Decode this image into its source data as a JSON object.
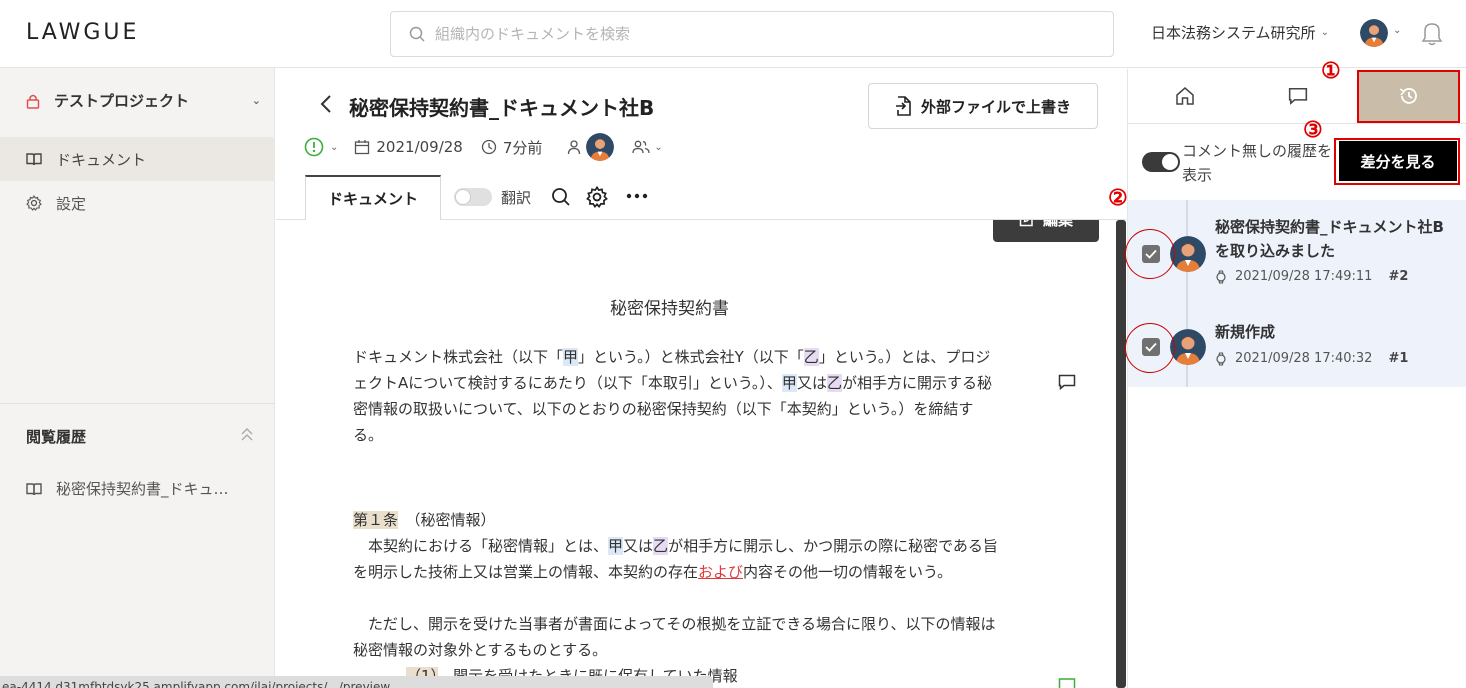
{
  "app": {
    "logo": "LAWGUE"
  },
  "search": {
    "placeholder": "組織内のドキュメントを検索"
  },
  "header": {
    "org_name": "日本法務システム研究所"
  },
  "sidebar": {
    "project_name": "テストプロジェクト",
    "nav": [
      {
        "label": "ドキュメント",
        "icon": "book-icon",
        "active": true
      },
      {
        "label": "設定",
        "icon": "gear-icon",
        "active": false
      }
    ],
    "history_title": "閲覧履歴",
    "history_items": [
      {
        "label": "秘密保持契約書_ドキュ…"
      }
    ]
  },
  "status_url": "ea-4414.d31mfbtdsyk25.amplifyapp.com/ilai/projects/.../preview",
  "document": {
    "title": "秘密保持契約書_ドキュメント社B",
    "overwrite_button": "外部ファイルで上書き",
    "date": "2021/09/28",
    "updated_ago": "7分前",
    "tab_label": "ドキュメント",
    "translate_label": "翻訳",
    "edit_button": "編集",
    "contract_title": "秘密保持契約書",
    "p1": {
      "a": "ドキュメント株式会社（以下「",
      "kou1": "甲",
      "b": "」という。）と株式会社Y（以下「",
      "otsu1": "乙",
      "c": "」という。）とは、プロジェクトAについて検討するにあたり（以下「本取引」という。）、",
      "kou2": "甲",
      "d": "又は",
      "otsu2": "乙",
      "e": "が相手方に開示する秘密情報の取扱いについて、以下のとおりの秘密保持契約（以下「本契約」という。）を締結する。"
    },
    "article1": {
      "number": "第１条",
      "heading": "（秘密情報）"
    },
    "p2": {
      "a": "　本契約における「秘密情報」とは、",
      "kou": "甲",
      "b": "又は",
      "otsu": "乙",
      "c": "が相手方に開示し、かつ開示の際に秘密である旨を明示した技術上又は営業上の情報、本契約の存在",
      "red": "および",
      "d": "内容その他一切の情報をいう。"
    },
    "p3": "　ただし、開示を受けた当事者が書面によってその根拠を立証できる場合に限り、以下の情報は秘密情報の対象外とするものとする。",
    "item1": {
      "number": "（1）",
      "text": "開示を受けたときに既に保有していた情報"
    }
  },
  "right_panel": {
    "toggle_label": "コメント無しの履歴を表示",
    "diff_button": "差分を見る",
    "entries": [
      {
        "title": "秘密保持契約書_ドキュメント社Bを取り込みました",
        "timestamp": "2021/09/28 17:49:11",
        "version": "#2",
        "checked": true
      },
      {
        "title": "新規作成",
        "timestamp": "2021/09/28 17:40:32",
        "version": "#1",
        "checked": true
      }
    ]
  },
  "annotations": [
    "①",
    "②",
    "③"
  ],
  "colors": {
    "accent_tab": "#c9bda9",
    "annotation_red": "#e00000",
    "diff_button": "#000000"
  }
}
